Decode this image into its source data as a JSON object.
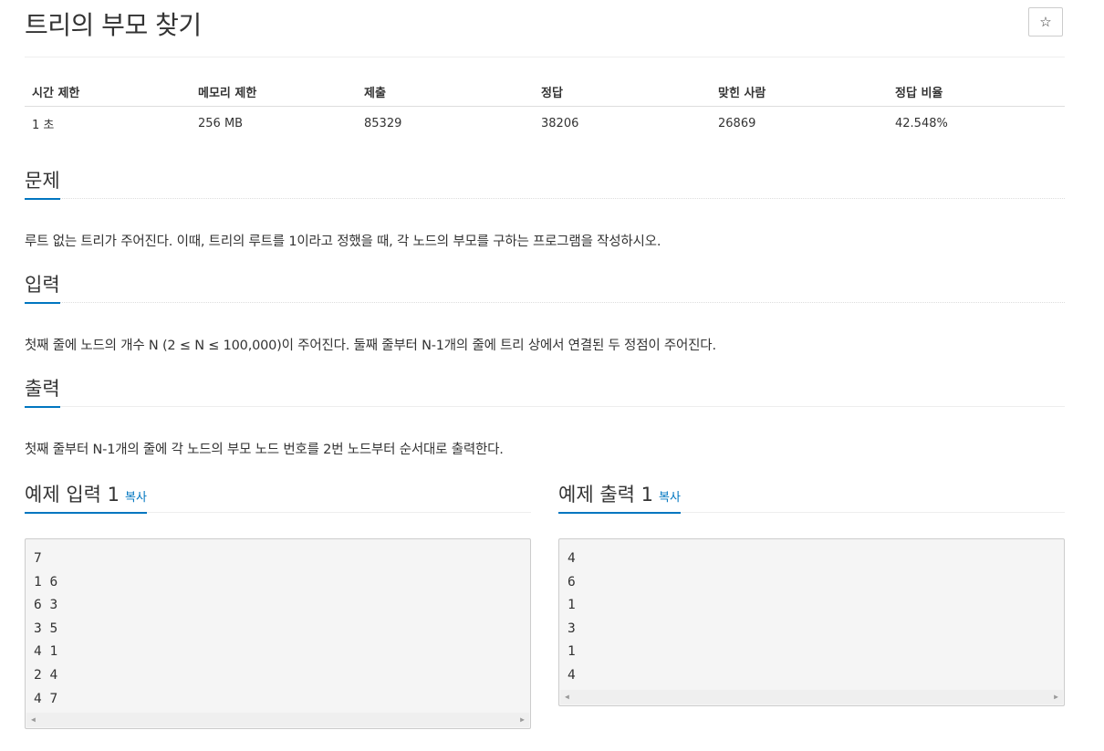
{
  "title": "트리의 부모 찾기",
  "star_label": "☆",
  "info_table": {
    "headers": [
      "시간 제한",
      "메모리 제한",
      "제출",
      "정답",
      "맞힌 사람",
      "정답 비율"
    ],
    "values": [
      "1 초",
      "256 MB",
      "85329",
      "38206",
      "26869",
      "42.548%"
    ]
  },
  "sections": {
    "problem": {
      "heading": "문제",
      "text": "루트 없는 트리가 주어진다. 이때, 트리의 루트를 1이라고 정했을 때, 각 노드의 부모를 구하는 프로그램을 작성하시오."
    },
    "input": {
      "heading": "입력",
      "text": "첫째 줄에 노드의 개수 N (2 ≤ N ≤ 100,000)이 주어진다. 둘째 줄부터 N-1개의 줄에 트리 상에서 연결된 두 정점이 주어진다."
    },
    "output": {
      "heading": "출력",
      "text": "첫째 줄부터 N-1개의 줄에 각 노드의 부모 노드 번호를 2번 노드부터 순서대로 출력한다."
    }
  },
  "examples": {
    "input": {
      "heading": "예제 입력 1",
      "copy_label": "복사",
      "content": "7\n1 6\n6 3\n3 5\n4 1\n2 4\n4 7"
    },
    "output": {
      "heading": "예제 출력 1",
      "copy_label": "복사",
      "content": "4\n6\n1\n3\n1\n4"
    }
  },
  "scroll_arrows": {
    "left": "◀",
    "right": "▶"
  }
}
